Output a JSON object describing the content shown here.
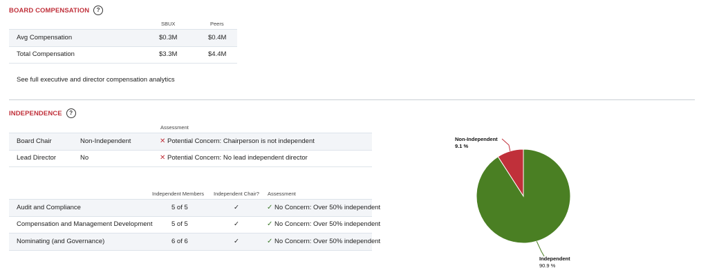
{
  "board_compensation": {
    "title": "BOARD COMPENSATION",
    "columns": [
      "SBUX",
      "Peers"
    ],
    "rows": [
      {
        "label": "Avg Compensation",
        "sbux": "$0.3M",
        "peers": "$0.4M"
      },
      {
        "label": "Total Compensation",
        "sbux": "$3.3M",
        "peers": "$4.4M"
      }
    ],
    "link_text": "See full executive and director compensation analytics"
  },
  "independence": {
    "title": "INDEPENDENCE",
    "leadership": {
      "assessment_header": "Assessment",
      "rows": [
        {
          "label": "Board Chair",
          "value": "Non-Independent",
          "assessment": "Potential Concern: Chairperson is not independent"
        },
        {
          "label": "Lead Director",
          "value": "No",
          "assessment": "Potential Concern: No lead independent director"
        }
      ]
    },
    "committees": {
      "headers": {
        "members": "Independent Members",
        "chair": "Independent Chair?",
        "assessment": "Assessment"
      },
      "rows": [
        {
          "name": "Audit and Compliance",
          "members": "5 of 5",
          "chair": "✓",
          "assessment": "No Concern: Over 50% independent"
        },
        {
          "name": "Compensation and Management Development",
          "members": "5 of 5",
          "chair": "✓",
          "assessment": "No Concern: Over 50% independent"
        },
        {
          "name": "Nominating (and Governance)",
          "members": "6 of 6",
          "chair": "✓",
          "assessment": "No Concern: Over 50% independent"
        }
      ]
    },
    "chart_data": {
      "type": "pie",
      "labels": [
        "Non-Independent",
        "Independent"
      ],
      "values": [
        9.1,
        90.9
      ],
      "value_labels": [
        "9.1 %",
        "90.9 %"
      ],
      "colors": [
        "#c0303a",
        "#4a7f23"
      ]
    }
  },
  "icons": {
    "help": "?",
    "cross": "✕",
    "check": "✓"
  }
}
